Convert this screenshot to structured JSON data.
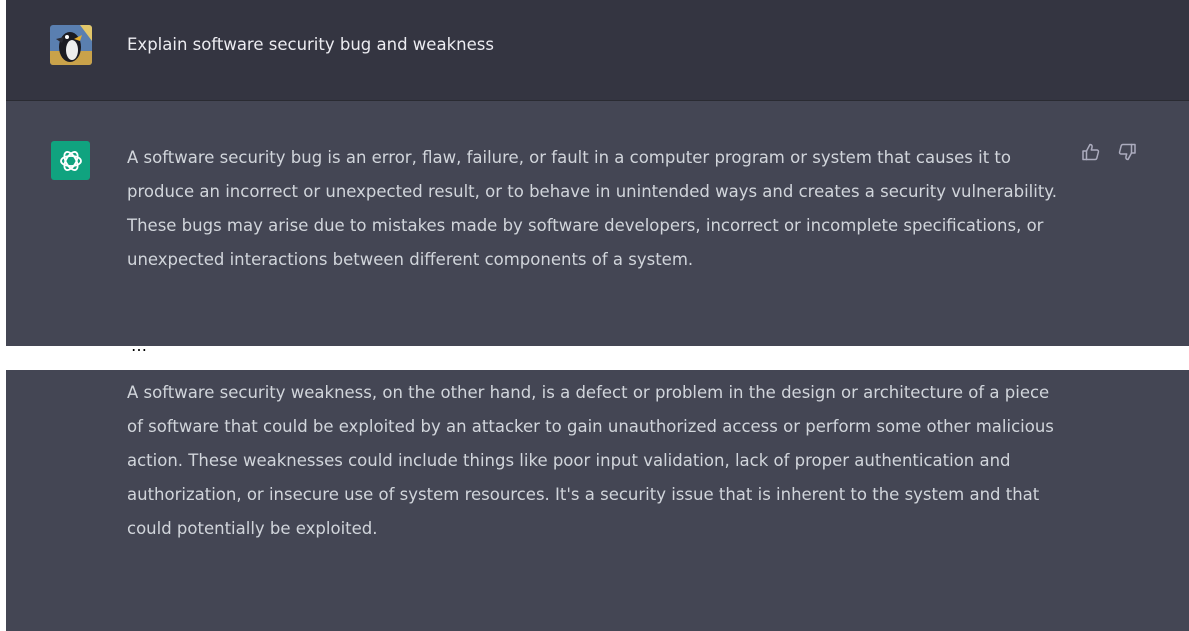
{
  "conversation": {
    "user_message": "Explain software security bug and weakness",
    "assistant_paragraph_1": "A software security bug is an error, flaw, failure, or fault in a computer program or system that causes it to produce an incorrect or unexpected result, or to behave in unintended ways and creates a security vulnerability. These bugs may arise due to mistakes made by software developers, incorrect or incomplete specifications, or unexpected interactions between different components of a system.",
    "separator": "…",
    "assistant_paragraph_2": "A software security weakness, on the other hand, is a defect or problem in the design or architecture of a piece of software that could be exploited by an attacker to gain unauthorized access or perform some other malicious action. These weaknesses could include things like poor input validation, lack of proper authentication and authorization, or insecure use of system resources. It's a security issue that is inherent to the system and that could potentially be exploited."
  },
  "icons": {
    "user_avatar": "user-avatar-penguin",
    "assistant_avatar": "openai-logo-icon",
    "thumbs_up": "thumbs-up-icon",
    "thumbs_down": "thumbs-down-icon"
  },
  "colors": {
    "user_row_bg": "#343541",
    "assistant_row_bg": "#444654",
    "text": "#d1d5db",
    "accent": "#10a37f"
  }
}
